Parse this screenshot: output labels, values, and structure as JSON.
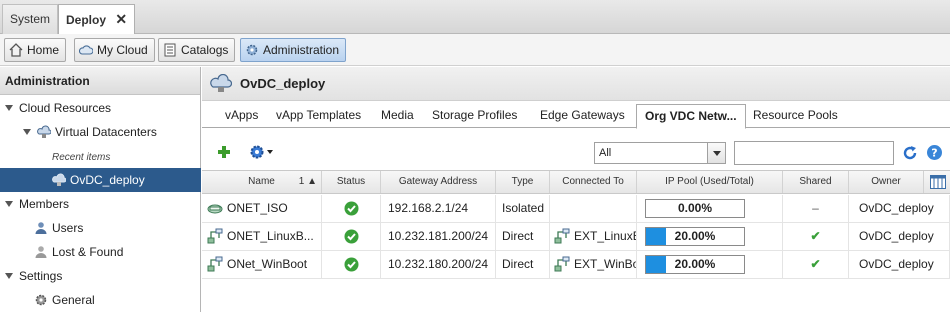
{
  "top_tabs": [
    {
      "label": "System"
    },
    {
      "label": "Deploy",
      "close": "✕"
    }
  ],
  "nav": {
    "home": "Home",
    "mycloud": "My Cloud",
    "catalogs": "Catalogs",
    "administration": "Administration"
  },
  "sidebar": {
    "header": "Administration",
    "cloud_resources": "Cloud Resources",
    "virtual_datacenters": "Virtual Datacenters",
    "recent_items": "Recent items",
    "ovdc_deploy": "OvDC_deploy",
    "members": "Members",
    "users": "Users",
    "lost_found": "Lost & Found",
    "settings": "Settings",
    "general": "General"
  },
  "main": {
    "title": "OvDC_deploy",
    "tabs": [
      "vApps",
      "vApp Templates",
      "Media",
      "Storage Profiles",
      "Edge Gateways",
      "Org VDC Netw...",
      "Resource Pools"
    ],
    "filter_value": "All",
    "search_placeholder": ""
  },
  "table": {
    "headers": {
      "name": "Name",
      "sort": "1 ▲",
      "status": "Status",
      "gateway": "Gateway Address",
      "type": "Type",
      "connected": "Connected To",
      "pool": "IP Pool (Used/Total)",
      "shared": "Shared",
      "owner": "Owner"
    },
    "rows": [
      {
        "name": "ONET_ISO",
        "gateway": "192.168.2.1/24",
        "type": "Isolated",
        "connected": "",
        "pool": "0.00%",
        "pool_fraction": 0.0,
        "shared": "–",
        "owner": "OvDC_deploy"
      },
      {
        "name": "ONET_LinuxB...",
        "gateway": "10.232.181.200/24",
        "type": "Direct",
        "connected": "EXT_LinuxBo",
        "pool": "20.00%",
        "pool_fraction": 0.2,
        "shared": "✔",
        "owner": "OvDC_deploy"
      },
      {
        "name": "ONet_WinBoot",
        "gateway": "10.232.180.200/24",
        "type": "Direct",
        "connected": "EXT_WinBoo",
        "pool": "20.00%",
        "pool_fraction": 0.2,
        "shared": "✔",
        "owner": "OvDC_deploy"
      }
    ]
  },
  "colors": {
    "accent": "#2c5a8c",
    "status_ok": "#3aa03a",
    "pool_fill": "#1e8fe0",
    "add": "#3c9c2c"
  },
  "icons": [
    "home-icon",
    "cloud-icon",
    "catalog-icon",
    "admin-gear-icon",
    "vdc-icon",
    "user-icon",
    "gear-icon",
    "add-icon",
    "actions-gear-icon",
    "refresh-icon",
    "help-icon",
    "columns-icon",
    "network-icon",
    "status-ok-icon"
  ]
}
